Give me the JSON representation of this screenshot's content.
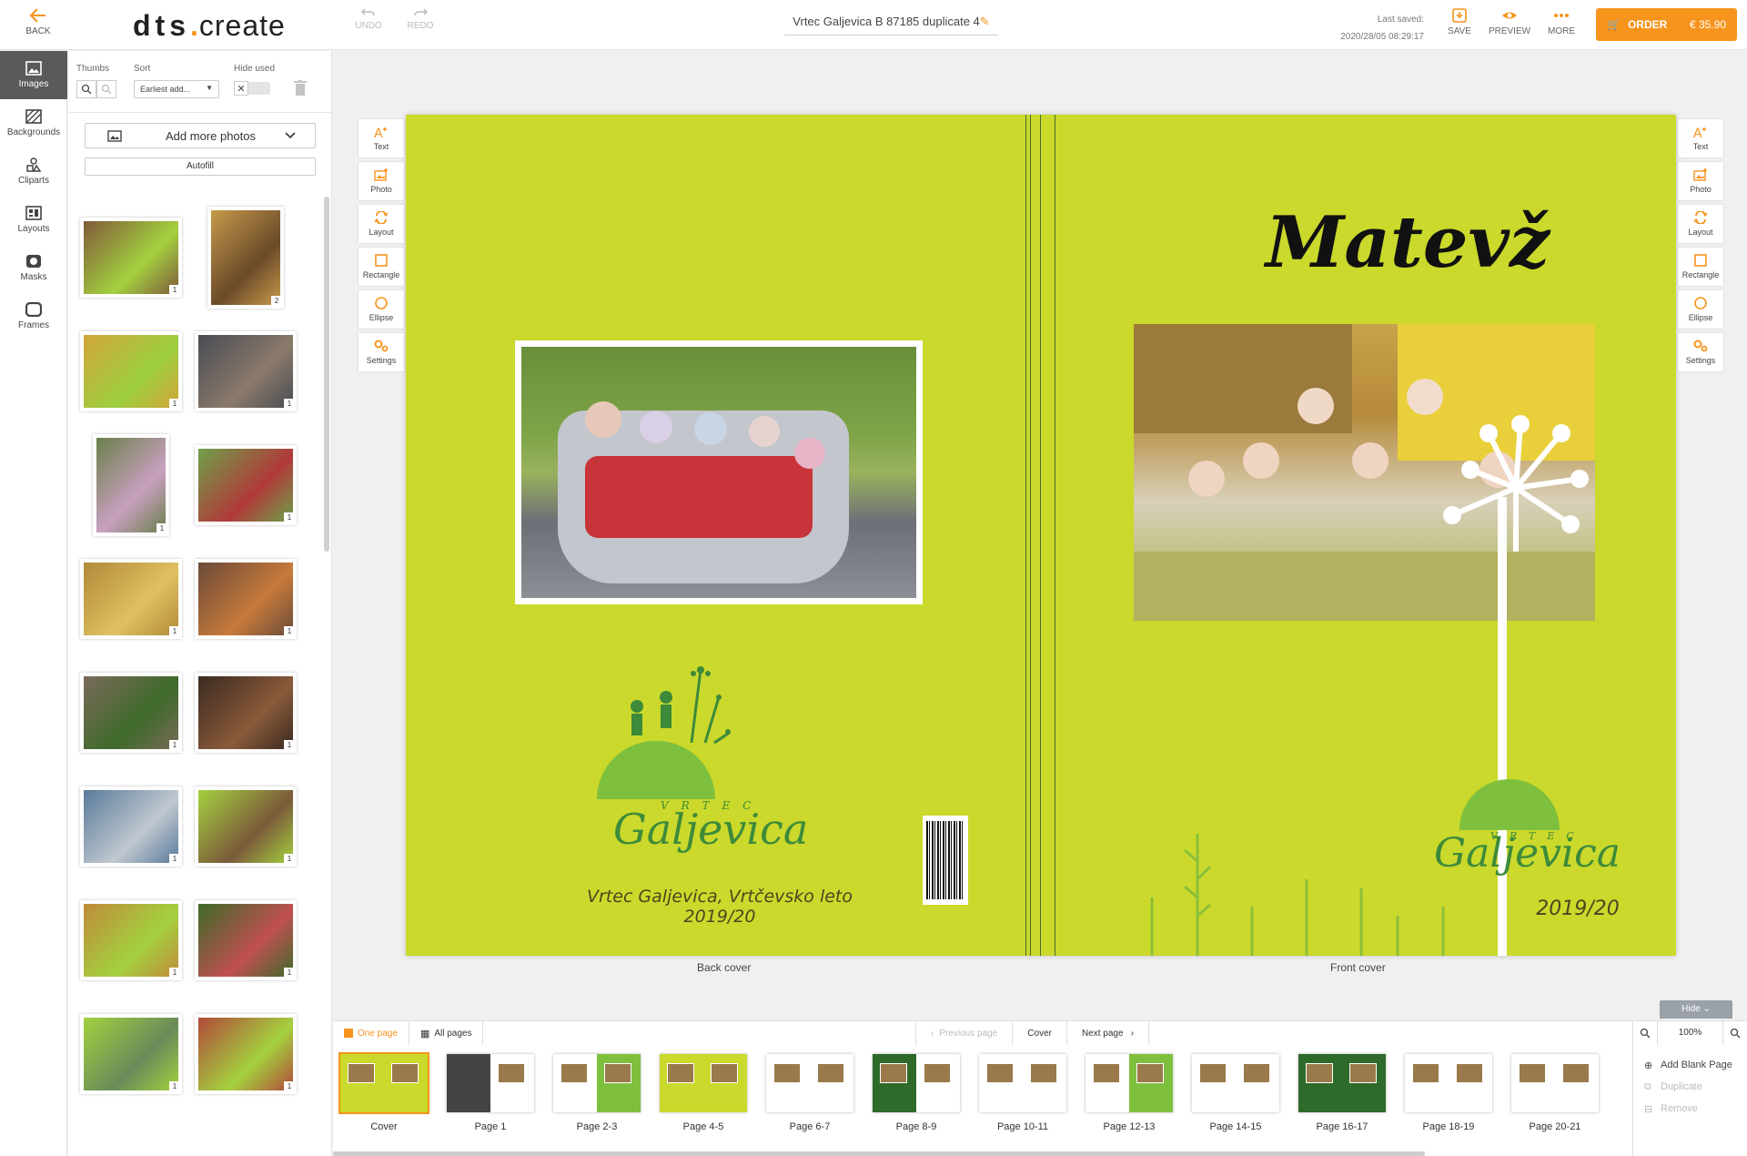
{
  "topbar": {
    "back_label": "BACK",
    "logo_main": "dts",
    "logo_dot": ".",
    "logo_rest": "create",
    "undo_label": "UNDO",
    "redo_label": "REDO",
    "project_title": "Vrtec Galjevica B 87185 duplicate 4",
    "last_saved_label": "Last saved:",
    "last_saved_value": "2020/28/05 08:29:17",
    "save_label": "SAVE",
    "preview_label": "PREVIEW",
    "more_label": "MORE",
    "order_label": "ORDER",
    "order_price": "€ 35.90",
    "accent_color": "#f7941d"
  },
  "rail": {
    "items": [
      {
        "label": "Images",
        "icon": "image-icon",
        "active": true
      },
      {
        "label": "Backgrounds",
        "icon": "background-icon"
      },
      {
        "label": "Cliparts",
        "icon": "clipart-icon"
      },
      {
        "label": "Layouts",
        "icon": "layout-icon"
      },
      {
        "label": "Masks",
        "icon": "mask-icon"
      },
      {
        "label": "Frames",
        "icon": "frame-icon"
      }
    ]
  },
  "panel": {
    "thumbs_label": "Thumbs",
    "sort_label": "Sort",
    "sort_value": "Earliest add...",
    "hide_used_label": "Hide used",
    "add_photos_label": "Add more photos",
    "autofill_label": "Autofill",
    "thumb_counts": [
      "1",
      "2",
      "1",
      "1",
      "1",
      "1",
      "1",
      "1",
      "1",
      "1",
      "1",
      "1",
      "1",
      "1",
      "1",
      "1"
    ]
  },
  "tools": [
    "Text",
    "Photo",
    "Layout",
    "Rectangle",
    "Ellipse",
    "Settings"
  ],
  "canvas": {
    "front_title": "Matevž",
    "back_caption": "Vrtec Galjevica, Vrtčevsko leto 2019/20",
    "logo_small": "VRTEC",
    "logo_name": "Galjevica",
    "front_year": "2019/20",
    "back_cover_label": "Back cover",
    "front_cover_label": "Front cover",
    "hide_label": "Hide",
    "background_color": "#cad92b"
  },
  "bottom": {
    "one_page_label": "One page",
    "all_pages_label": "All pages",
    "prev_label": "Previous page",
    "cover_label": "Cover",
    "next_label": "Next page",
    "zoom_value": "100%",
    "pages": [
      "Cover",
      "Page 1",
      "Page 2-3",
      "Page 4-5",
      "Page 6-7",
      "Page 8-9",
      "Page 10-11",
      "Page 12-13",
      "Page 14-15",
      "Page 16-17",
      "Page 18-19",
      "Page 20-21"
    ],
    "add_blank_label": "Add Blank Page",
    "duplicate_label": "Duplicate",
    "remove_label": "Remove"
  }
}
